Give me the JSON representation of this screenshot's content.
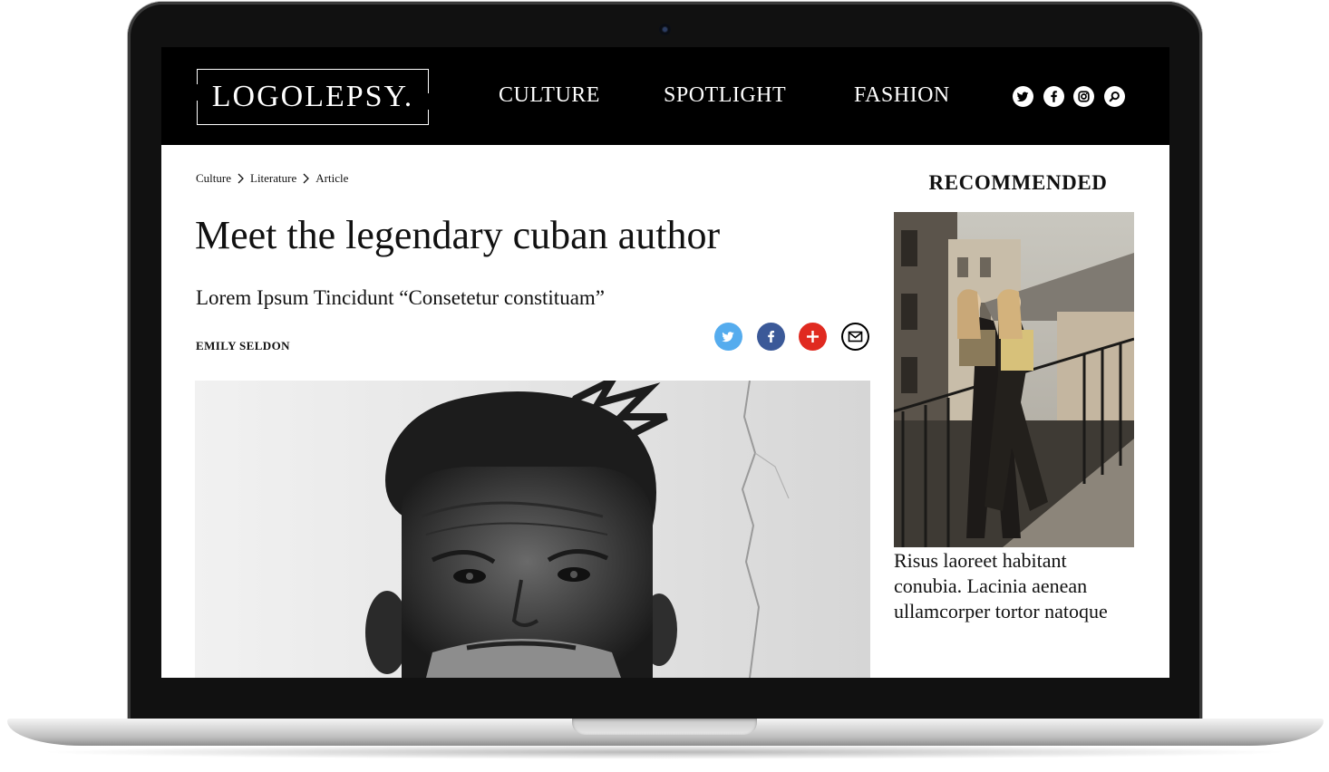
{
  "site": {
    "logo": "LOGOLEPSY.",
    "nav": [
      "CULTURE",
      "SPOTLIGHT",
      "FASHION"
    ],
    "header_icons": [
      "twitter-icon",
      "facebook-icon",
      "instagram-icon",
      "search-icon"
    ]
  },
  "breadcrumb": [
    "Culture",
    "Literature",
    "Article"
  ],
  "article": {
    "title": "Meet the legendary cuban author",
    "subtitle": "Lorem Ipsum Tincidunt “Consetetur constituam”",
    "author": "EMILY SELDON"
  },
  "share": [
    {
      "icon": "twitter-icon",
      "color": "#55acee"
    },
    {
      "icon": "facebook-icon",
      "color": "#3b5998"
    },
    {
      "icon": "plus-icon",
      "color": "#e02a20"
    },
    {
      "icon": "mail-icon",
      "color": "#000000"
    }
  ],
  "sidebar": {
    "heading": "RECOMMENDED",
    "item_text": "Risus laoreet habitant conubia. Lacinia aenean ullamcorper tortor natoque"
  }
}
